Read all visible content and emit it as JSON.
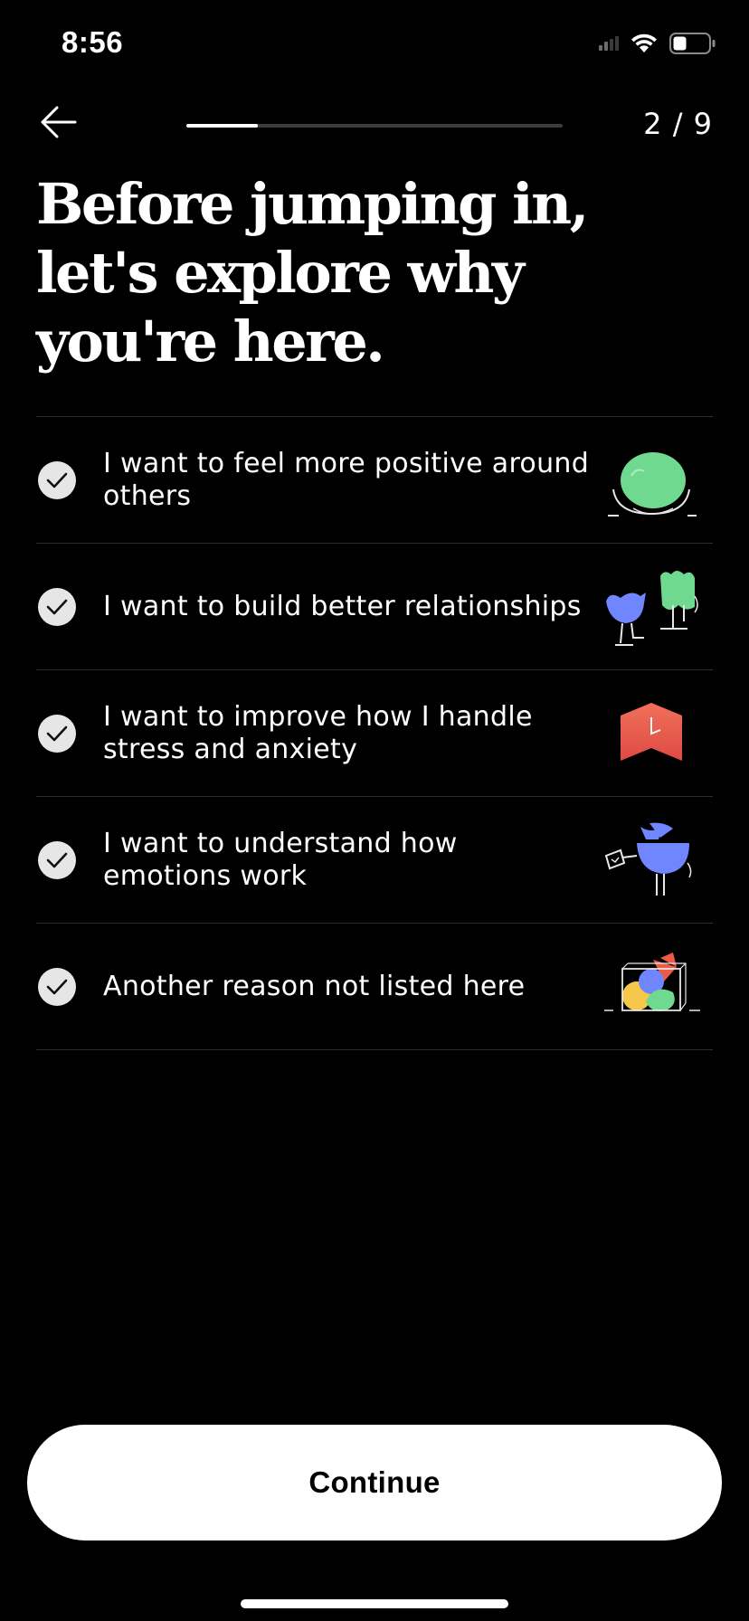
{
  "status_bar": {
    "time": "8:56",
    "signal_icon": "cellular-signal-icon",
    "wifi_icon": "wifi-icon",
    "battery_icon": "battery-icon"
  },
  "nav": {
    "back_icon": "arrow-left-icon",
    "progress_fraction": 0.19,
    "step_counter": "2 / 9"
  },
  "title": "Before jumping in, let's explore why you're here.",
  "options": [
    {
      "label": "I want to feel more positive around others",
      "checked": true,
      "illustration": "green-blob-bowl-illustration"
    },
    {
      "label": "I want to build better relationships",
      "checked": true,
      "illustration": "blue-bird-green-plant-illustration"
    },
    {
      "label": "I want to improve how I handle stress and anxiety",
      "checked": true,
      "illustration": "red-clock-banner-illustration"
    },
    {
      "label": "I want to understand how emotions work",
      "checked": true,
      "illustration": "blue-creature-flag-illustration"
    },
    {
      "label": "Another reason not listed here",
      "checked": true,
      "illustration": "colorful-shapes-box-illustration"
    }
  ],
  "continue_label": "Continue",
  "colors": {
    "background": "#000000",
    "check_fill": "#e6e6e6",
    "divider": "#2c2c2c",
    "progress_track": "#3c3c3c",
    "accent_green": "#6fd98f",
    "accent_blue": "#6f86ff",
    "accent_red": "#ec5b48",
    "accent_yellow": "#f5c84b"
  }
}
